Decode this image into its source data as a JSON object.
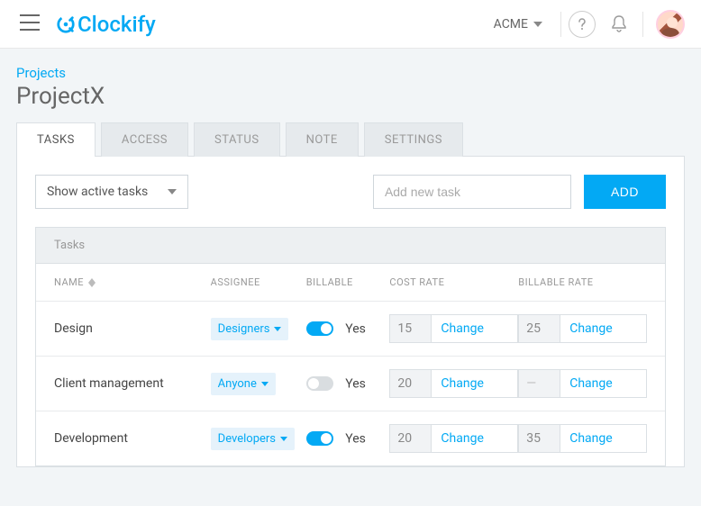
{
  "header": {
    "logo": "Clockify",
    "workspace": "ACME"
  },
  "breadcrumb": "Projects",
  "page_title": "ProjectX",
  "tabs": [
    {
      "label": "TASKS",
      "active": true
    },
    {
      "label": "ACCESS",
      "active": false
    },
    {
      "label": "STATUS",
      "active": false
    },
    {
      "label": "NOTE",
      "active": false
    },
    {
      "label": "SETTINGS",
      "active": false
    }
  ],
  "controls": {
    "filter_label": "Show active tasks",
    "new_task_placeholder": "Add new task",
    "add_label": "ADD"
  },
  "table": {
    "title": "Tasks",
    "columns": {
      "name": "NAME",
      "assignee": "ASSIGNEE",
      "billable": "BILLABLE",
      "cost": "COST RATE",
      "rate": "BILLABLE RATE"
    },
    "billable_yes": "Yes",
    "change_label": "Change",
    "rows": [
      {
        "name": "Design",
        "assignee": "Designers",
        "billable_on": true,
        "cost": "15",
        "rate": "25"
      },
      {
        "name": "Client management",
        "assignee": "Anyone",
        "billable_on": false,
        "cost": "20",
        "rate": "—"
      },
      {
        "name": "Development",
        "assignee": "Developers",
        "billable_on": true,
        "cost": "20",
        "rate": "35"
      }
    ]
  }
}
